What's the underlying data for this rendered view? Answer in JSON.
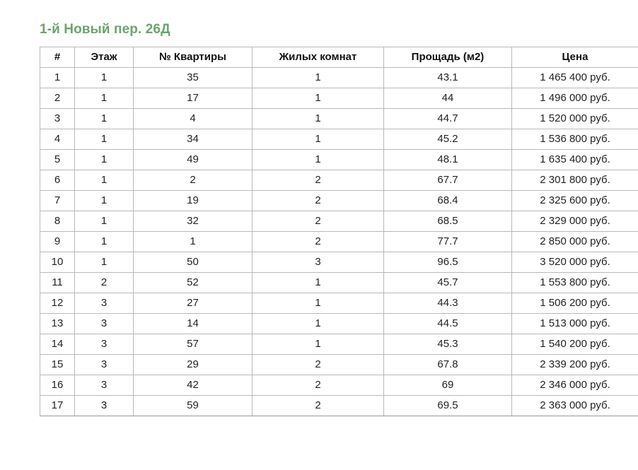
{
  "page": {
    "title": "1-й Новый пер. 26Д",
    "accent_color": "#6aa56b"
  },
  "table": {
    "headers": [
      "#",
      "Этаж",
      "№ Квартиры",
      "Жилых комнат",
      "Прощадь (м2)",
      "Цена"
    ],
    "rows": [
      [
        "1",
        "1",
        "35",
        "1",
        "43.1",
        "1 465 400 руб."
      ],
      [
        "2",
        "1",
        "17",
        "1",
        "44",
        "1 496 000 руб."
      ],
      [
        "3",
        "1",
        "4",
        "1",
        "44.7",
        "1 520 000 руб."
      ],
      [
        "4",
        "1",
        "34",
        "1",
        "45.2",
        "1 536 800 руб."
      ],
      [
        "5",
        "1",
        "49",
        "1",
        "48.1",
        "1 635 400 руб."
      ],
      [
        "6",
        "1",
        "2",
        "2",
        "67.7",
        "2 301 800 руб."
      ],
      [
        "7",
        "1",
        "19",
        "2",
        "68.4",
        "2 325 600 руб."
      ],
      [
        "8",
        "1",
        "32",
        "2",
        "68.5",
        "2 329 000 руб."
      ],
      [
        "9",
        "1",
        "1",
        "2",
        "77.7",
        "2 850 000 руб."
      ],
      [
        "10",
        "1",
        "50",
        "3",
        "96.5",
        "3 520 000 руб."
      ],
      [
        "11",
        "2",
        "52",
        "1",
        "45.7",
        "1 553 800 руб."
      ],
      [
        "12",
        "3",
        "27",
        "1",
        "44.3",
        "1 506 200 руб."
      ],
      [
        "13",
        "3",
        "14",
        "1",
        "44.5",
        "1 513 000 руб."
      ],
      [
        "14",
        "3",
        "57",
        "1",
        "45.3",
        "1 540 200 руб."
      ],
      [
        "15",
        "3",
        "29",
        "2",
        "67.8",
        "2 339 200 руб."
      ],
      [
        "16",
        "3",
        "42",
        "2",
        "69",
        "2 346 000 руб."
      ],
      [
        "17",
        "3",
        "59",
        "2",
        "69.5",
        "2 363 000 руб."
      ]
    ]
  }
}
